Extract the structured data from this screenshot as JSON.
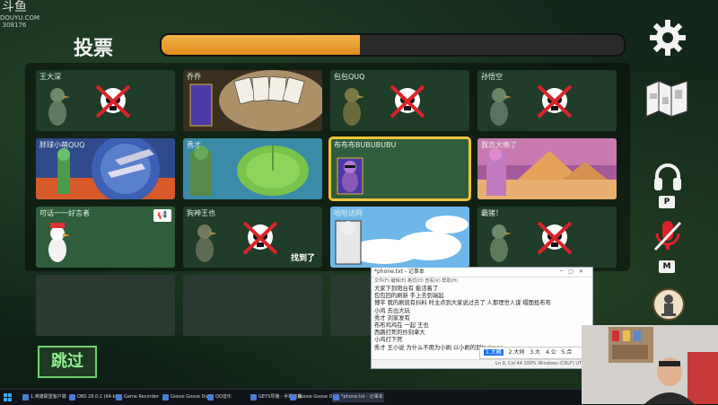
{
  "watermark": {
    "logo": "斗鱼",
    "sub": "DOUYU.COM",
    "room": "308176"
  },
  "vote": {
    "title": "投票",
    "timer_fraction": 0.43
  },
  "players": [
    {
      "name": "王大深",
      "state": "dead"
    },
    {
      "name": "乔乔",
      "state": "cards"
    },
    {
      "name": "包包QUQ",
      "state": "dead"
    },
    {
      "name": "孙悟空",
      "state": "dead"
    },
    {
      "name": "胖球小萌QUQ",
      "state": "banner-space"
    },
    {
      "name": "秀才",
      "state": "banner-lily"
    },
    {
      "name": "布布布BUBUBUBU",
      "state": "selected"
    },
    {
      "name": "我恋大晚了",
      "state": "banner-desert"
    },
    {
      "name": "可话一一好言者",
      "state": "speaker",
      "badge": "📢"
    },
    {
      "name": "狗神王也",
      "state": "dead-found",
      "found_label": "找到了"
    },
    {
      "name": "哈哈达阿",
      "state": "banner-sky"
    },
    {
      "name": "霸猪！",
      "state": "dead"
    }
  ],
  "skip_label": "跳过",
  "side_labels": {
    "mute_key": "P",
    "map_key": "M"
  },
  "chat_window": {
    "title": "*phone.txt - 记事本",
    "menu": "文件(F)  编辑(E)  格式(O)  查看(V)  帮助(H)",
    "lines": [
      "大家下到阳台有 能活着了",
      "包包回的刷新 手上去到瑞起",
      "博平 我的刷就有抖料 时主点到大家说过去了 人那理世人谋 帽面投布布",
      "小鸡 去出大玩",
      "秀才 刘家发有",
      "布布鸡鸡在 一起 王也",
      "西路打死的抄刻拿大",
      "小鸡打下死",
      "秀才 王小说 为什么不用为小刷 以小刷的到tariman"
    ],
    "ime_candidates": [
      "1.大概",
      "2.大同",
      "3.大",
      "4.公",
      "5.合"
    ],
    "status": "Ln 9, Col 44     100%     Windows (CRLF)     UTF-8"
  },
  "taskbar": {
    "items": [
      "1.英雄联盟客户端",
      "OBS 28.0.2 (64-bit)",
      "Game Recorder",
      "Goose Goose Duck",
      "QQ音乐",
      "GEYS导播 - 手机直播",
      "Goose Goose Duck",
      "*phone.txt - 记事本"
    ]
  },
  "colors": {
    "card": "#2f5e3c",
    "selected_border": "#f0c23a",
    "timer": "#e8991f",
    "skip": "#6ed36e"
  }
}
